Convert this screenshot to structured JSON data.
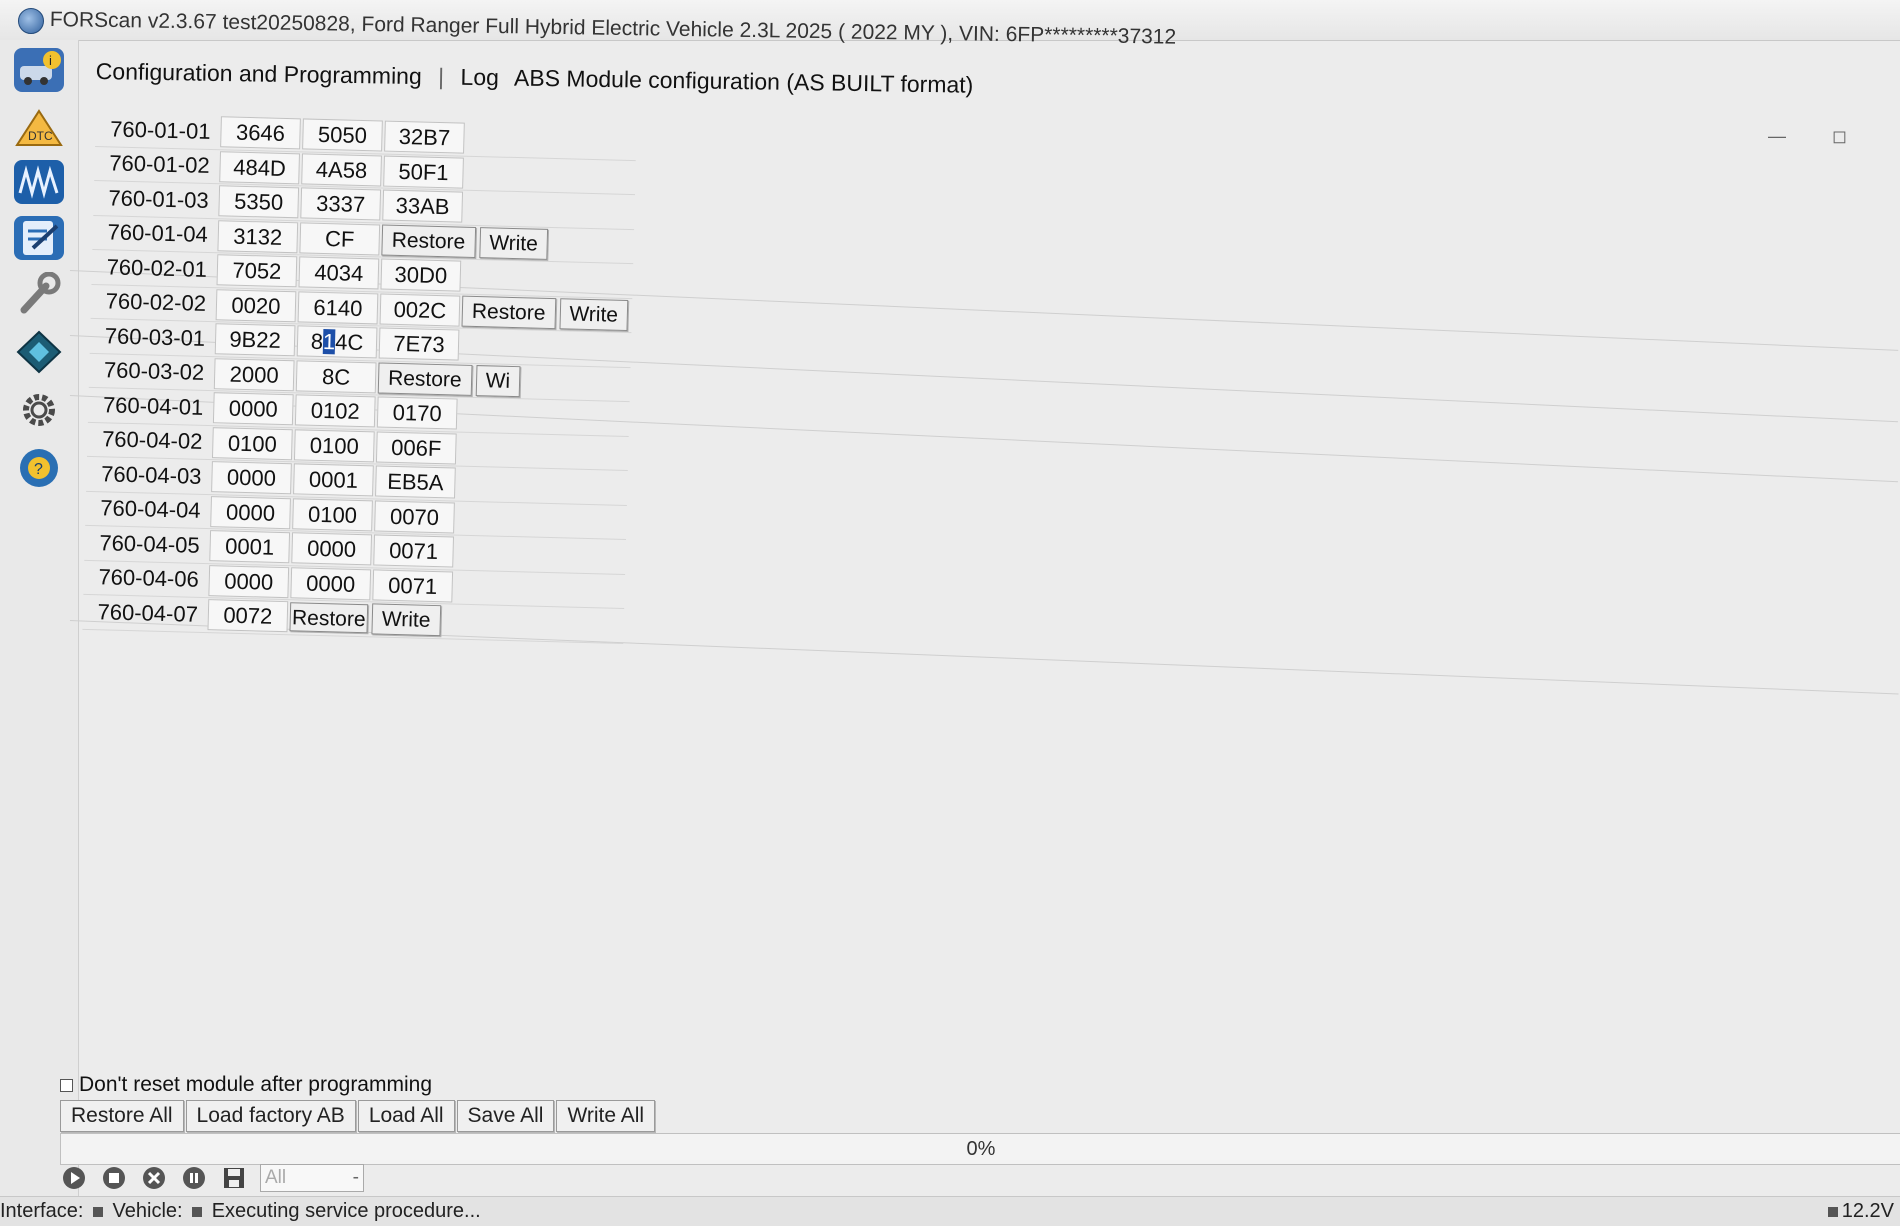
{
  "window": {
    "title": "FORScan v2.3.67 test20250828, Ford Ranger Full Hybrid Electric Vehicle 2.3L 2025 ( 2022 MY ), VIN: 6FP*********37312",
    "minimize": "—",
    "restore": "◻"
  },
  "sidebar": {
    "items": [
      {
        "name": "vehicle-info-icon"
      },
      {
        "name": "dtc-icon",
        "label": "DTC"
      },
      {
        "name": "oscilloscope-icon"
      },
      {
        "name": "checklist-icon"
      },
      {
        "name": "wrench-icon"
      },
      {
        "name": "programming-icon"
      },
      {
        "name": "settings-gear-icon"
      },
      {
        "name": "help-icon"
      }
    ]
  },
  "tabs": {
    "config": "Configuration and Programming",
    "sep": "|",
    "log": "Log",
    "abs": "ABS Module configuration (AS BUILT format)"
  },
  "config": {
    "rows": [
      {
        "label": "760-01-01",
        "cells": [
          "3646",
          "5050",
          "32B7"
        ]
      },
      {
        "label": "760-01-02",
        "cells": [
          "484D",
          "4A58",
          "50F1"
        ]
      },
      {
        "label": "760-01-03",
        "cells": [
          "5350",
          "3337",
          "33AB"
        ]
      },
      {
        "label": "760-01-04",
        "cells": [
          "3132",
          "CF"
        ],
        "restore": "Restore",
        "write": "Write"
      },
      {
        "label": "760-02-01",
        "cells": [
          "7052",
          "4034",
          "30D0"
        ]
      },
      {
        "label": "760-02-02",
        "cells": [
          "0020",
          "6140",
          "002C"
        ],
        "restore": "Restore",
        "write": "Write"
      },
      {
        "label": "760-03-01",
        "cells": [
          "9B22",
          "8",
          "1",
          "4C",
          "7E73"
        ]
      },
      {
        "label": "760-03-02",
        "cells": [
          "2000",
          "8C"
        ],
        "restore": "Restore",
        "write": "Wi"
      },
      {
        "label": "760-04-01",
        "cells": [
          "0000",
          "0102",
          "0170"
        ]
      },
      {
        "label": "760-04-02",
        "cells": [
          "0100",
          "0100",
          "006F"
        ]
      },
      {
        "label": "760-04-03",
        "cells": [
          "0000",
          "0001",
          "EB5A"
        ]
      },
      {
        "label": "760-04-04",
        "cells": [
          "0000",
          "0100",
          "0070"
        ]
      },
      {
        "label": "760-04-05",
        "cells": [
          "0001",
          "0000",
          "0071"
        ]
      },
      {
        "label": "760-04-06",
        "cells": [
          "0000",
          "0000",
          "0071"
        ]
      },
      {
        "label": "760-04-07",
        "cells": [
          "0072"
        ],
        "restore": "Restore",
        "write": "Write"
      }
    ]
  },
  "bottom": {
    "checkbox_label": "Don't reset module after programming",
    "restore_all": "Restore All",
    "load_factory": "Load factory AB",
    "load_all": "Load All",
    "save_all": "Save All",
    "write_all": "Write All",
    "progress_text": "0%",
    "progress_value": 0
  },
  "toolbar": {
    "filter_value": "All",
    "filter_arrow": "-"
  },
  "status": {
    "interface": "Interface:",
    "vehicle": "Vehicle:",
    "message": "Executing service procedure...",
    "voltage": "12.2V"
  }
}
